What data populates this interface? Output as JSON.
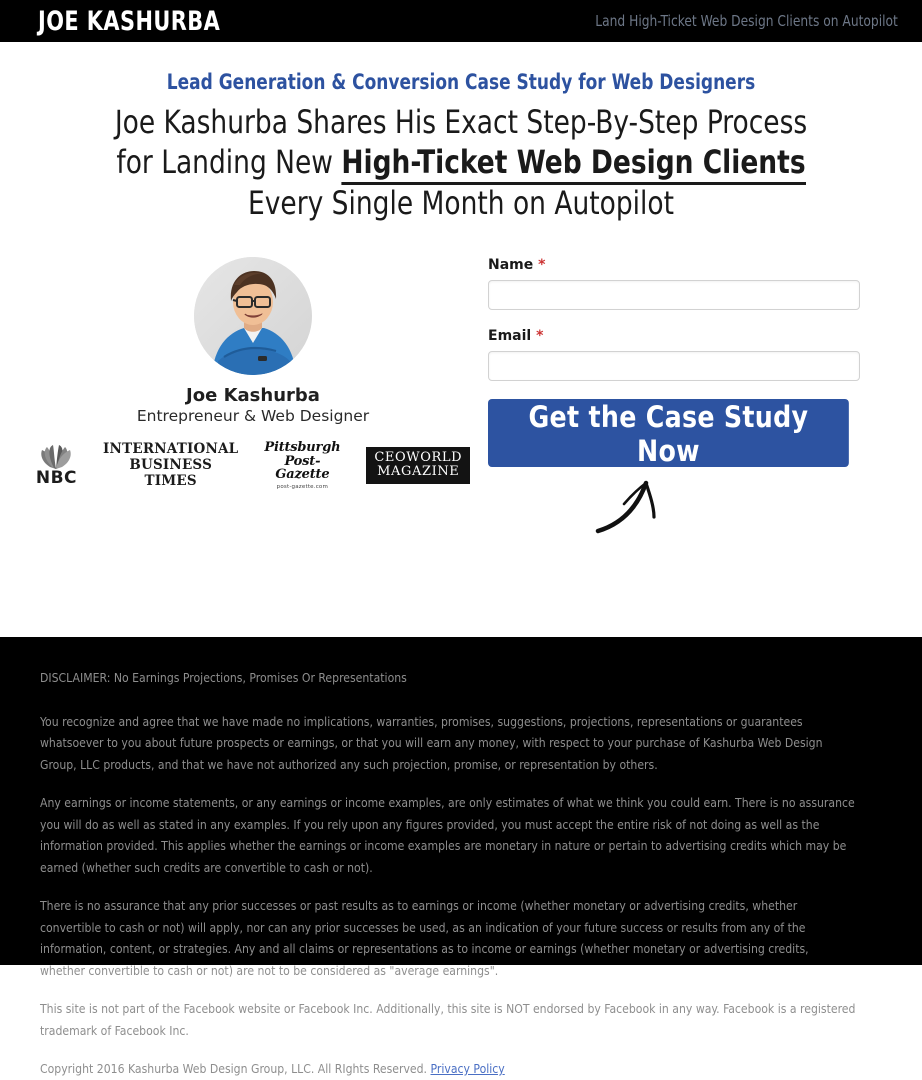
{
  "header": {
    "brand": "JOE KASHURBA",
    "tagline": "Land High-Ticket Web Design Clients on Autopilot"
  },
  "hero": {
    "eyebrow": "Lead Generation & Conversion Case Study for Web Designers",
    "headline_line1": "Joe Kashurba Shares His Exact Step-By-Step Process",
    "headline_line2_pre": "for Landing New ",
    "headline_line2_emphasis": "High-Ticket Web Design Clients",
    "headline_line3": "Every Single Month on Autopilot"
  },
  "profile": {
    "avatar_alt": "portrait-photo-of-joe-kashurba",
    "name": "Joe Kashurba",
    "role": "Entrepreneur & Web Designer"
  },
  "press": {
    "nbc_label": "NBC",
    "ibt_line1": "INTERNATIONAL",
    "ibt_line2": "BUSINESS TIMES",
    "pg_line1": "Pittsburgh",
    "pg_line2": "Post-Gazette",
    "pg_url": "post-gazette.com",
    "ceo_line1": "CEOWORLD",
    "ceo_line2": "MAGAZINE"
  },
  "form": {
    "name_label": "Name",
    "name_required": "*",
    "name_value": "",
    "name_placeholder": "",
    "email_label": "Email",
    "email_required": "*",
    "email_value": "",
    "email_placeholder": "",
    "submit_label": "Get the Case Study Now"
  },
  "footer": {
    "disclaimer_title": "DISCLAIMER: No Earnings Projections, Promises Or Representations",
    "paragraph_1": "You recognize and agree that we have made no implications, warranties, promises, suggestions, projections, representations or guarantees whatsoever to you about future prospects or earnings, or that you will earn any money, with respect to your purchase of Kashurba Web Design Group, LLC products, and that we have not authorized any such projection, promise, or representation by others.",
    "paragraph_2": "Any earnings or income statements, or any earnings or income examples, are only estimates of what we think you could earn. There is no assurance you will do as well as stated in any examples. If you rely upon any figures provided, you must accept the entire risk of not doing as well as the information provided. This applies whether the earnings or income examples are monetary in nature or pertain to advertising credits which may be earned (whether such credits are convertible to cash or not).",
    "paragraph_3": "There is no assurance that any prior successes or past results as to earnings or income (whether monetary or advertising credits, whether convertible to cash or not) will apply, nor can any prior successes be used, as an indication of your future success or results from any of the information, content, or strategies. Any and all claims or representations as to income or earnings (whether monetary or advertising credits, whether convertible to cash or not) are not to be considered as \"average earnings\".",
    "paragraph_4": "This site is not part of the Facebook website or Facebook Inc. Additionally, this site is NOT endorsed by Facebook in any way. Facebook is a registered trademark of Facebook Inc.",
    "copyright": "Copyright 2016 Kashurba Web Design Group, LLC. All RIghts Reserved. ",
    "privacy_link": "Privacy Policy"
  },
  "colors": {
    "accent_blue": "#2d53a1",
    "header_black": "#000000",
    "footer_text": "#8e8e8e",
    "required_red": "#cc3333",
    "link_blue": "#4a6fc4"
  }
}
